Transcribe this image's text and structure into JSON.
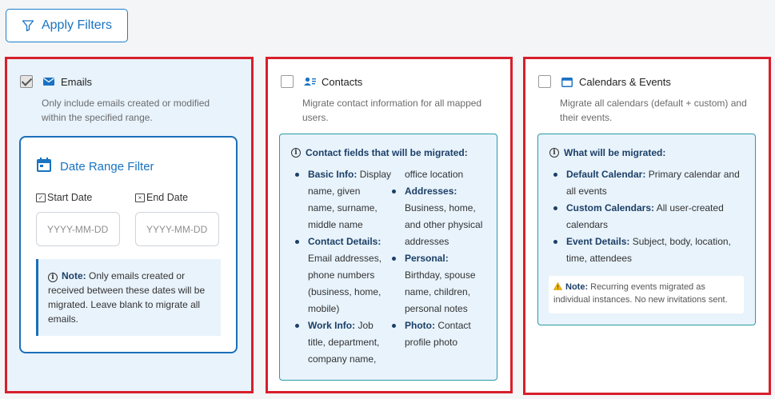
{
  "toolbar": {
    "apply_filters_label": "Apply Filters"
  },
  "emails": {
    "checked": true,
    "title": "Emails",
    "description_line1": "Only include emails created or modified",
    "description_line2": "within the specified range.",
    "date_filter": {
      "title": "Date Range Filter",
      "start_label": "Start Date",
      "end_label": "End Date",
      "start_placeholder": "YYYY-MM-DD",
      "end_placeholder": "YYYY-MM-DD",
      "note_label": "Note:",
      "note_line1": "Only emails created or",
      "note_line2": "received between these dates will be",
      "note_line3": "migrated. Leave blank to migrate all",
      "note_line4": "emails."
    }
  },
  "contacts": {
    "checked": false,
    "title": "Contacts",
    "description_line1": "Migrate contact information for all mapped",
    "description_line2": "users.",
    "info_title": "Contact fields that will be migrated:",
    "col1": [
      {
        "label": "Basic Info:",
        "lines": [
          "Display",
          "name, given",
          "name, surname,",
          "middle name"
        ]
      },
      {
        "label": "Contact Details:",
        "lines": [
          "",
          "Email addresses,",
          "phone numbers",
          "(business, home,",
          "mobile)"
        ]
      },
      {
        "label": "Work Info:",
        "lines": [
          "Job",
          "title, department,",
          "company name,"
        ]
      }
    ],
    "col2_top": "office location",
    "col2": [
      {
        "label": "Addresses:",
        "lines": [
          "",
          "Business, home,",
          "and other physical",
          "addresses"
        ]
      },
      {
        "label": "Personal:",
        "lines": [
          "",
          "Birthday, spouse",
          "name, children,",
          "personal notes"
        ]
      },
      {
        "label": "Photo:",
        "lines": [
          "Contact",
          "profile photo"
        ]
      }
    ]
  },
  "calendars": {
    "checked": false,
    "title": "Calendars & Events",
    "description_line1": "Migrate all calendars (default + custom) and",
    "description_line2": "their events.",
    "info_title": "What will be migrated:",
    "items": [
      {
        "label": "Default Calendar:",
        "first": "Primary calendar and",
        "rest": "all events"
      },
      {
        "label": "Custom Calendars:",
        "first": "All user-created",
        "rest": "calendars"
      },
      {
        "label": "Event Details:",
        "first": "Subject, body, location,",
        "rest": "time, attendees"
      }
    ],
    "warn_label": "Note:",
    "warn_line1": "Recurring events migrated as",
    "warn_line2": "individual instances. No new invitations sent."
  },
  "colors": {
    "accent": "#1a73c2",
    "highlight_border": "#d71f2b",
    "info_border": "#2b9aa5",
    "selected_bg": "#e8f3fc"
  }
}
